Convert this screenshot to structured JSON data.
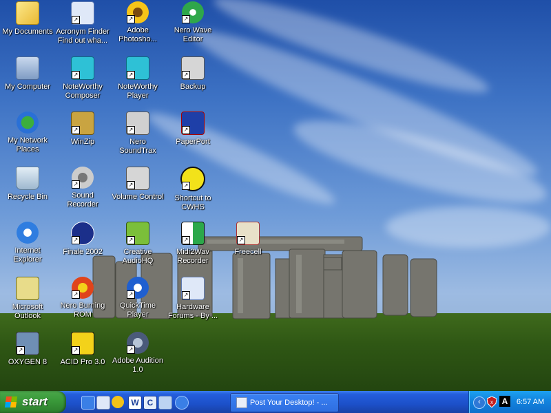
{
  "desktop": {
    "icons": [
      {
        "label": "My Documents",
        "icon": "folder-icon"
      },
      {
        "label": "Acronym Finder\nFind out wha...",
        "icon": "ie-shortcut-icon"
      },
      {
        "label": "Adobe\nPhotosho...",
        "icon": "sunflower-icon"
      },
      {
        "label": "Nero Wave\nEditor",
        "icon": "nero-wave-icon"
      },
      {
        "label": "My Computer",
        "icon": "computer-icon"
      },
      {
        "label": "NoteWorthy\nComposer",
        "icon": "music-icon"
      },
      {
        "label": "NoteWorthy\nPlayer",
        "icon": "music-player-icon"
      },
      {
        "label": "Backup",
        "icon": "backup-icon"
      },
      {
        "label": "My Network\nPlaces",
        "icon": "network-icon"
      },
      {
        "label": "WinZip",
        "icon": "winzip-icon"
      },
      {
        "label": "Nero\nSoundTrax",
        "icon": "nero-soundtrax-icon"
      },
      {
        "label": "PaperPort",
        "icon": "paperport-icon"
      },
      {
        "label": "Recycle Bin",
        "icon": "recycle-bin-icon"
      },
      {
        "label": "Sound\nRecorder",
        "icon": "speaker-icon"
      },
      {
        "label": "Volume Control",
        "icon": "volume-icon"
      },
      {
        "label": "Shortcut to\nCWHS",
        "icon": "headphones-icon"
      },
      {
        "label": "Internet\nExplorer",
        "icon": "ie-icon"
      },
      {
        "label": "Finale 2002",
        "icon": "finale-icon"
      },
      {
        "label": "Creative\nAudioHQ",
        "icon": "audiohq-icon"
      },
      {
        "label": "Midi2Wav\nRecorder",
        "icon": "midi-icon"
      },
      {
        "label": "Freecell",
        "icon": "freecell-icon"
      },
      {
        "label": "Microsoft\nOutlook",
        "icon": "outlook-icon"
      },
      {
        "label": "Nero Burning\nROM",
        "icon": "nero-burning-icon"
      },
      {
        "label": "QuickTime\nPlayer",
        "icon": "quicktime-icon"
      },
      {
        "label": "Hardware\nForums - By ...",
        "icon": "ie-shortcut-icon"
      },
      {
        "label": "OXYGEN 8",
        "icon": "oxygen-icon"
      },
      {
        "label": "ACID Pro 3.0",
        "icon": "acid-icon"
      },
      {
        "label": "Adobe Audition\n1.0",
        "icon": "audition-icon"
      }
    ]
  },
  "taskbar": {
    "start_label": "start",
    "quick_launch": [
      "ie-icon",
      "desktop-icon",
      "media-player-icon",
      "word-icon",
      "c-app-icon",
      "outlook-express-icon",
      "ie-icon"
    ],
    "task_button": "Post Your Desktop! - ...",
    "clock": "6:57 AM",
    "tray_icons": [
      "chevron-left-icon",
      "shield-icon",
      "acrobat-icon"
    ]
  },
  "colors": {
    "taskbar": "#245edb",
    "start_button": "#3b9b3b",
    "tray": "#1386e0"
  }
}
